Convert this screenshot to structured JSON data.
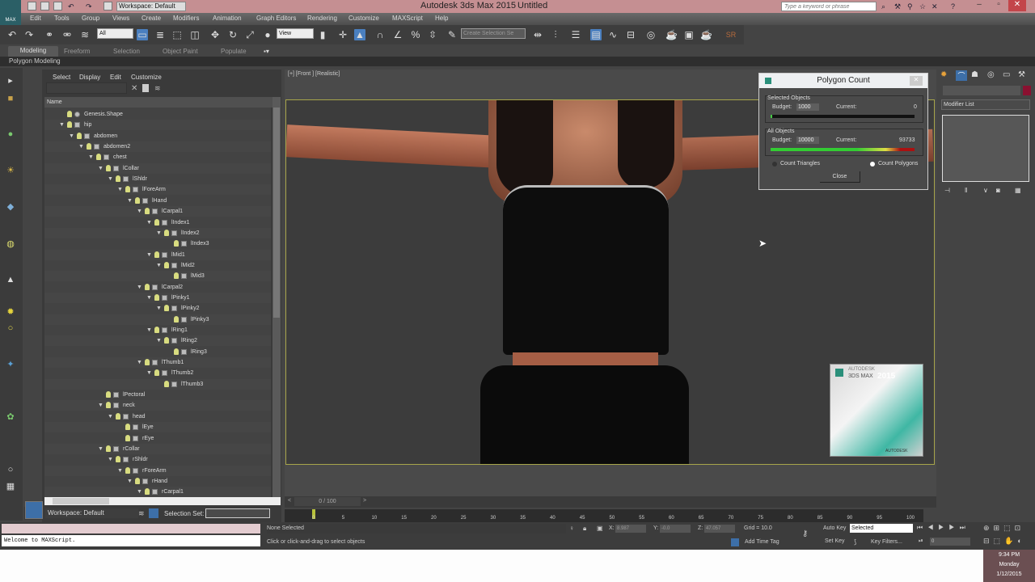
{
  "titlebar": {
    "app_title": "Autodesk 3ds Max  2015",
    "doc_title": "Untitled",
    "workspace": "Workspace: Default",
    "search_placeholder": "Type a keyword or phrase",
    "logo": "MAX"
  },
  "menu": [
    "Edit",
    "Tools",
    "Group",
    "Views",
    "Create",
    "Modifiers",
    "Animation",
    "Graph Editors",
    "Rendering",
    "Customize",
    "MAXScript",
    "Help"
  ],
  "toolbar": {
    "selection_filter": "All",
    "ref_coord": "View",
    "named_selection": "Create Selection Se",
    "sr_label": "SR"
  },
  "ribbon": {
    "tabs": [
      "Modeling",
      "Freeform",
      "Selection",
      "Object Paint",
      "Populate"
    ],
    "panel": "Polygon Modeling"
  },
  "explorer": {
    "menu": [
      "Select",
      "Display",
      "Edit",
      "Customize"
    ],
    "column": "Name",
    "items": [
      {
        "name": "Genesis.Shape",
        "depth": 0,
        "expand": false
      },
      {
        "name": "hip",
        "depth": 0,
        "expand": true
      },
      {
        "name": "abdomen",
        "depth": 1,
        "expand": true
      },
      {
        "name": "abdomen2",
        "depth": 2,
        "expand": true
      },
      {
        "name": "chest",
        "depth": 3,
        "expand": true
      },
      {
        "name": "lCollar",
        "depth": 4,
        "expand": true
      },
      {
        "name": "lShldr",
        "depth": 5,
        "expand": true
      },
      {
        "name": "lForeArm",
        "depth": 6,
        "expand": true
      },
      {
        "name": "lHand",
        "depth": 7,
        "expand": true
      },
      {
        "name": "lCarpal1",
        "depth": 8,
        "expand": true
      },
      {
        "name": "lIndex1",
        "depth": 9,
        "expand": true
      },
      {
        "name": "lIndex2",
        "depth": 10,
        "expand": true
      },
      {
        "name": "lIndex3",
        "depth": 11,
        "expand": false
      },
      {
        "name": "lMid1",
        "depth": 9,
        "expand": true
      },
      {
        "name": "lMid2",
        "depth": 10,
        "expand": true
      },
      {
        "name": "lMid3",
        "depth": 11,
        "expand": false
      },
      {
        "name": "lCarpal2",
        "depth": 8,
        "expand": true
      },
      {
        "name": "lPinky1",
        "depth": 9,
        "expand": true
      },
      {
        "name": "lPinky2",
        "depth": 10,
        "expand": true
      },
      {
        "name": "lPinky3",
        "depth": 11,
        "expand": false
      },
      {
        "name": "lRing1",
        "depth": 9,
        "expand": true
      },
      {
        "name": "lRing2",
        "depth": 10,
        "expand": true
      },
      {
        "name": "lRing3",
        "depth": 11,
        "expand": false
      },
      {
        "name": "lThumb1",
        "depth": 8,
        "expand": true
      },
      {
        "name": "lThumb2",
        "depth": 9,
        "expand": true
      },
      {
        "name": "lThumb3",
        "depth": 10,
        "expand": false
      },
      {
        "name": "lPectoral",
        "depth": 4,
        "expand": false
      },
      {
        "name": "neck",
        "depth": 4,
        "expand": true
      },
      {
        "name": "head",
        "depth": 5,
        "expand": true
      },
      {
        "name": "lEye",
        "depth": 6,
        "expand": false
      },
      {
        "name": "rEye",
        "depth": 6,
        "expand": false
      },
      {
        "name": "rCollar",
        "depth": 4,
        "expand": true
      },
      {
        "name": "rShldr",
        "depth": 5,
        "expand": true
      },
      {
        "name": "rForeArm",
        "depth": 6,
        "expand": true
      },
      {
        "name": "rHand",
        "depth": 7,
        "expand": true
      },
      {
        "name": "rCarpal1",
        "depth": 8,
        "expand": true
      }
    ],
    "workspace": "Workspace: Default",
    "selection_set_label": "Selection Set:"
  },
  "viewport": {
    "label": "[+] [Front ] [Realistic]"
  },
  "polygon_count": {
    "title": "Polygon Count",
    "selected": {
      "group": "Selected Objects",
      "budget_label": "Budget:",
      "budget": "1000",
      "current_label": "Current:",
      "current": "0",
      "fill": 0.0
    },
    "all": {
      "group": "All Objects",
      "budget_label": "Budget:",
      "budget": "10000",
      "current_label": "Current:",
      "current": "93733",
      "fill": 1.0
    },
    "count_triangles": "Count Triangles",
    "count_polygons": "Count Polygons",
    "selected_mode": "polygons",
    "close": "Close"
  },
  "command_panel": {
    "modifier_list": "Modifier List",
    "color": "#8a1030"
  },
  "splash": {
    "brand": "AUTODESK",
    "product": "3DS MAX",
    "year": "2015",
    "footer": "AUTODESK"
  },
  "timeline": {
    "frame": "0 / 100",
    "ticks": [
      0,
      5,
      10,
      15,
      20,
      25,
      30,
      35,
      40,
      45,
      50,
      55,
      60,
      65,
      70,
      75,
      80,
      85,
      90,
      95,
      100
    ]
  },
  "status": {
    "maxscript_output": "Welcome to MAXScript.",
    "selection": "None Selected",
    "prompt": "Click or click-and-drag to select objects",
    "x_label": "X:",
    "x": "8.987",
    "y_label": "Y:",
    "y": "-0.0",
    "z_label": "Z:",
    "z": "47.057",
    "grid": "Grid = 10.0",
    "add_time_tag": "Add Time Tag",
    "auto_key": "Auto Key",
    "set_key": "Set Key",
    "key_mode": "Selected",
    "key_filters": "Key Filters...",
    "current_frame": "0"
  },
  "taskbar": {
    "time": "9:34 PM",
    "day": "Monday",
    "date": "1/12/2015"
  }
}
